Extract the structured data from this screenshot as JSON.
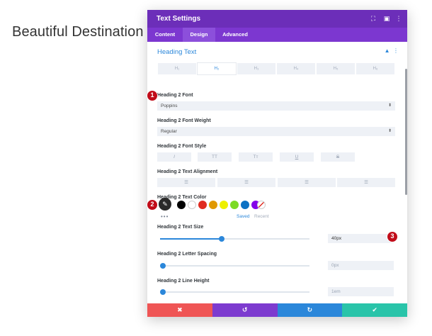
{
  "page": {
    "heading": "Beautiful Destination"
  },
  "modal": {
    "title": "Text Settings",
    "header_icons": [
      "expand-icon",
      "columns-icon",
      "more-icon"
    ],
    "tabs": [
      {
        "label": "Content",
        "active": false
      },
      {
        "label": "Design",
        "active": true
      },
      {
        "label": "Advanced",
        "active": false
      }
    ],
    "section": {
      "title": "Heading Text",
      "heading_tabs": [
        "H₁",
        "H₂",
        "H₃",
        "H₄",
        "H₅",
        "H₆"
      ],
      "active_heading_index": 1
    },
    "font": {
      "label": "Heading 2 Font",
      "value": "Poppins"
    },
    "weight": {
      "label": "Heading 2 Font Weight",
      "value": "Regular"
    },
    "style": {
      "label": "Heading 2 Font Style",
      "buttons": [
        "I",
        "TT",
        "Tт",
        "U",
        "S"
      ]
    },
    "alignment": {
      "label": "Heading 2 Text Alignment"
    },
    "color": {
      "label": "Heading 2 Text Color",
      "swatches": [
        "#000000",
        "#ffffff",
        "#e02b20",
        "#e09900",
        "#edf000",
        "#7cda24",
        "#0c71c3",
        "#8300e9"
      ],
      "more": "•••",
      "tab_saved": "Saved",
      "tab_recent": "Recent"
    },
    "size": {
      "label": "Heading 2 Text Size",
      "value": "40px",
      "fraction": 0.41
    },
    "letter_spacing": {
      "label": "Heading 2 Letter Spacing",
      "value": "0px",
      "fraction": 0.0
    },
    "line_height": {
      "label": "Heading 2 Line Height",
      "value": "1em",
      "fraction": 0.0
    },
    "footer": {
      "cancel": "✖",
      "undo": "↺",
      "redo": "↻",
      "save": "✔",
      "colors": [
        "#ef5555",
        "#7d3bcf",
        "#2b87da",
        "#29c4a9"
      ]
    }
  },
  "annotations": [
    "1",
    "2",
    "3"
  ]
}
